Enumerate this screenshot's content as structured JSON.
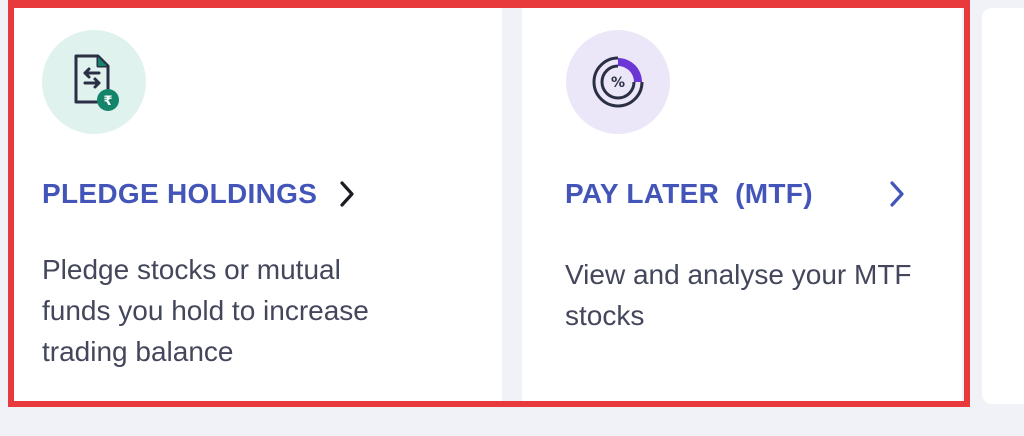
{
  "cards": [
    {
      "title": "PLEDGE HOLDINGS",
      "description_lines": [
        "Pledge stocks or mutual",
        "funds you hold to increase",
        "trading balance"
      ],
      "icon": "pledge-document-rupee-icon"
    },
    {
      "title": "PAY LATER",
      "title_suffix": "(MTF)",
      "description_lines": [
        "View and analyse your MTF",
        "stocks"
      ],
      "icon": "pay-later-percent-dial-icon"
    }
  ],
  "colors": {
    "title_accent": "#4355b9",
    "text": "#44475b",
    "chevron_dark": "#1c1c22",
    "highlight_border": "#e8393d",
    "icon_bg_green": "#dff2ee",
    "icon_bg_purple": "#ece7f8",
    "icon_purple_accent": "#6c35d5",
    "icon_green_accent": "#14856b"
  }
}
